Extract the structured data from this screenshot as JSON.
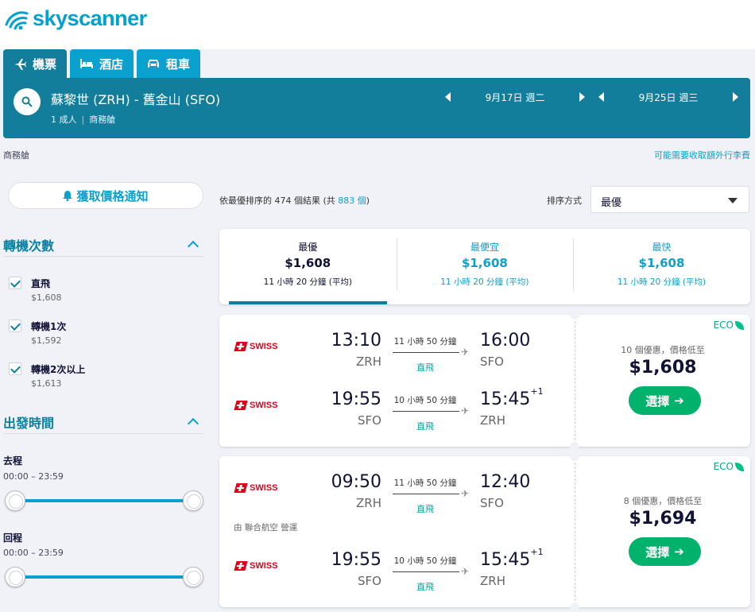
{
  "brand": {
    "name": "skyscanner",
    "color": "#00a0d0"
  },
  "tabs": [
    {
      "label": "機票",
      "icon": "plane-icon",
      "active": true
    },
    {
      "label": "酒店",
      "icon": "bed-icon",
      "active": false
    },
    {
      "label": "租車",
      "icon": "car-icon",
      "active": false
    }
  ],
  "search": {
    "route": "蘇黎世 (ZRH) - 舊金山 (SFO)",
    "passengers": "1 成人",
    "cabin": "商務艙",
    "depart_date": "9月17日 週二",
    "return_date": "9月25日 週三"
  },
  "subheader": {
    "cabin_label": "商務艙",
    "fee_notice": "可能需要收取額外行李費"
  },
  "price_alert": {
    "label": "獲取價格通知"
  },
  "filters": {
    "stops_title": "轉機次數",
    "stops": [
      {
        "label": "直飛",
        "price": "$1,608"
      },
      {
        "label": "轉機1次",
        "price": "$1,592"
      },
      {
        "label": "轉機2次以上",
        "price": "$1,613"
      }
    ],
    "time_title": "出發時間",
    "outbound_label": "去程",
    "outbound_range": "00:00 – 23:59",
    "return_label": "回程",
    "return_range": "00:00 – 23:59"
  },
  "results": {
    "prefix": "依最優排序的",
    "count": "474",
    "middle": "個結果 (共",
    "total": "883 個",
    "suffix": ")"
  },
  "sort": {
    "label": "排序方式",
    "selected": "最優"
  },
  "sort_tabs": [
    {
      "title": "最優",
      "price": "$1,608",
      "duration": "11 小時 20 分鐘 (平均)"
    },
    {
      "title": "最便宜",
      "price": "$1,608",
      "duration": "11 小時 20 分鐘 (平均)"
    },
    {
      "title": "最快",
      "price": "$1,608",
      "duration": "11 小時 20 分鐘 (平均)"
    }
  ],
  "flights": [
    {
      "eco": "ECO",
      "deals": "10 個優惠，價格低至",
      "price": "$1,608",
      "select": "選擇",
      "operated": "",
      "legs": [
        {
          "airline": "SWISS",
          "dep_time": "13:10",
          "dep_code": "ZRH",
          "duration": "11 小時 50 分鐘",
          "stops": "直飛",
          "arr_time": "16:00",
          "arr_code": "SFO",
          "day_offset": ""
        },
        {
          "airline": "SWISS",
          "dep_time": "19:55",
          "dep_code": "SFO",
          "duration": "10 小時 50 分鐘",
          "stops": "直飛",
          "arr_time": "15:45",
          "arr_code": "ZRH",
          "day_offset": "+1"
        }
      ]
    },
    {
      "eco": "ECO",
      "deals": "8 個優惠，價格低至",
      "price": "$1,694",
      "select": "選擇",
      "operated": "由 聯合航空 營運",
      "legs": [
        {
          "airline": "SWISS",
          "dep_time": "09:50",
          "dep_code": "ZRH",
          "duration": "11 小時 50 分鐘",
          "stops": "直飛",
          "arr_time": "12:40",
          "arr_code": "SFO",
          "day_offset": ""
        },
        {
          "airline": "SWISS",
          "dep_time": "19:55",
          "dep_code": "SFO",
          "duration": "10 小時 50 分鐘",
          "stops": "直飛",
          "arr_time": "15:45",
          "arr_code": "ZRH",
          "day_offset": "+1"
        }
      ]
    }
  ]
}
